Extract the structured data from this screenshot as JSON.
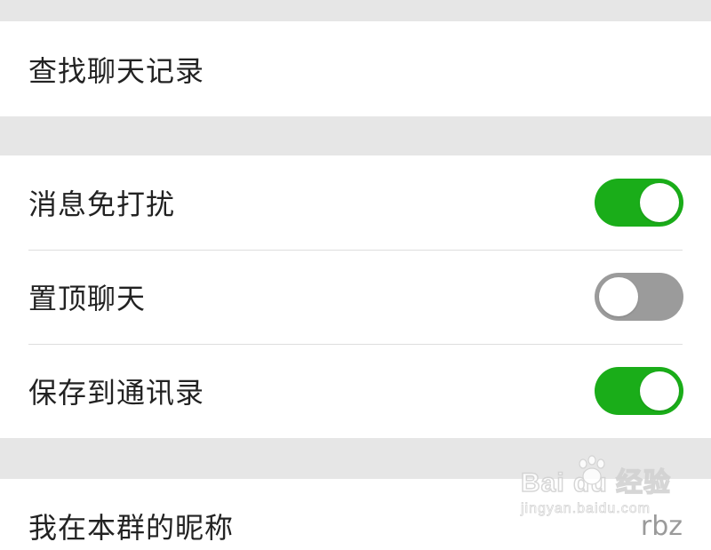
{
  "search_section": {
    "find_chat_history_label": "查找聊天记录"
  },
  "toggles_section": {
    "items": [
      {
        "label": "消息免打扰",
        "state": "on"
      },
      {
        "label": "置顶聊天",
        "state": "off"
      },
      {
        "label": "保存到通讯录",
        "state": "on"
      }
    ]
  },
  "nickname_section": {
    "label": "我在本群的昵称",
    "value": "rbz"
  },
  "watermark": {
    "brand": "Bai du 经验",
    "url": "jingyan.baidu.com"
  },
  "colors": {
    "switch_on": "#1aad19",
    "switch_off": "#9b9b9b",
    "background": "#e6e6e6"
  }
}
